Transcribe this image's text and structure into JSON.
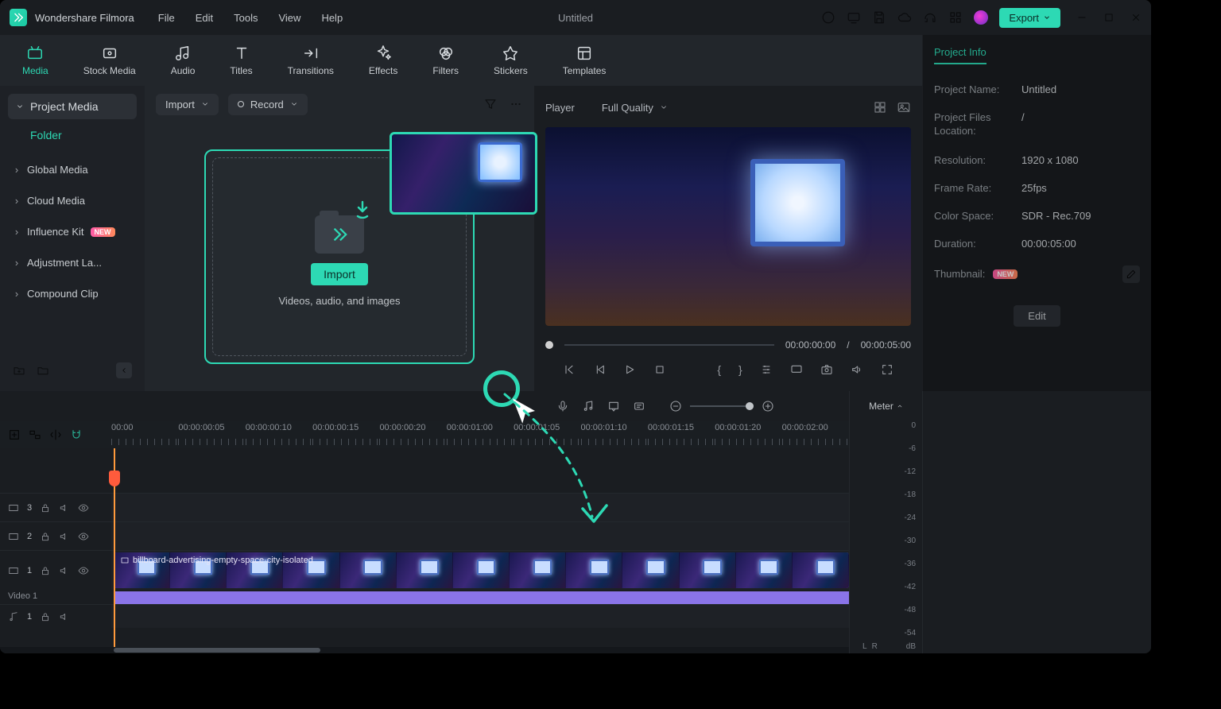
{
  "app_name": "Wondershare Filmora",
  "menus": [
    "File",
    "Edit",
    "Tools",
    "View",
    "Help"
  ],
  "title_center": "Untitled",
  "export_label": "Export",
  "tabs": [
    {
      "label": "Media"
    },
    {
      "label": "Stock Media"
    },
    {
      "label": "Audio"
    },
    {
      "label": "Titles"
    },
    {
      "label": "Transitions"
    },
    {
      "label": "Effects"
    },
    {
      "label": "Filters"
    },
    {
      "label": "Stickers"
    },
    {
      "label": "Templates"
    }
  ],
  "left": {
    "panel_title": "Project Media",
    "folder_label": "Folder",
    "tree": [
      {
        "label": "Global Media"
      },
      {
        "label": "Cloud Media"
      },
      {
        "label": "Influence Kit",
        "new": true
      },
      {
        "label": "Adjustment La..."
      },
      {
        "label": "Compound Clip"
      }
    ]
  },
  "media_toolbar": {
    "import": "Import",
    "record": "Record"
  },
  "dropzone": {
    "import_btn": "Import",
    "hint": "Videos, audio, and images"
  },
  "player": {
    "tab_label": "Player",
    "quality": "Full Quality",
    "current": "00:00:00:00",
    "sep": "/",
    "total": "00:00:05:00"
  },
  "timeline": {
    "ticks": [
      "00:00",
      "00:00:00:05",
      "00:00:00:10",
      "00:00:00:15",
      "00:00:00:20",
      "00:00:01:00",
      "00:00:01:05",
      "00:00:01:10",
      "00:00:01:15",
      "00:00:01:20",
      "00:00:02:00"
    ],
    "tracks": {
      "t3": "3",
      "t2": "2",
      "t1": "1",
      "v1_label": "Video 1",
      "a1": "1"
    },
    "clip_label": "billboard-advertising-empty-space-city-isolated"
  },
  "meter": {
    "label": "Meter",
    "scale": [
      "0",
      "-6",
      "-12",
      "-18",
      "-24",
      "-30",
      "-36",
      "-42",
      "-48",
      "-54"
    ],
    "L": "L",
    "R": "R",
    "db": "dB"
  },
  "info": {
    "title": "Project Info",
    "rows": [
      {
        "k": "Project Name:",
        "v": "Untitled"
      },
      {
        "k": "Project Files Location:",
        "v": "/"
      },
      {
        "k": "Resolution:",
        "v": "1920 x 1080"
      },
      {
        "k": "Frame Rate:",
        "v": "25fps"
      },
      {
        "k": "Color Space:",
        "v": "SDR - Rec.709"
      },
      {
        "k": "Duration:",
        "v": "00:00:05:00"
      }
    ],
    "thumb_label": "Thumbnail:",
    "edit": "Edit",
    "new_badge": "NEW"
  }
}
